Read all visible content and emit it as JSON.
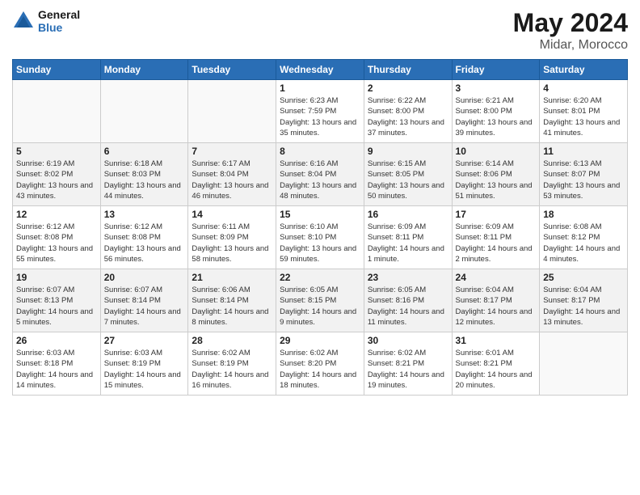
{
  "header": {
    "logo_line1": "General",
    "logo_line2": "Blue",
    "month": "May 2024",
    "location": "Midar, Morocco"
  },
  "weekdays": [
    "Sunday",
    "Monday",
    "Tuesday",
    "Wednesday",
    "Thursday",
    "Friday",
    "Saturday"
  ],
  "weeks": [
    [
      {
        "day": "",
        "info": ""
      },
      {
        "day": "",
        "info": ""
      },
      {
        "day": "",
        "info": ""
      },
      {
        "day": "1",
        "info": "Sunrise: 6:23 AM\nSunset: 7:59 PM\nDaylight: 13 hours\nand 35 minutes."
      },
      {
        "day": "2",
        "info": "Sunrise: 6:22 AM\nSunset: 8:00 PM\nDaylight: 13 hours\nand 37 minutes."
      },
      {
        "day": "3",
        "info": "Sunrise: 6:21 AM\nSunset: 8:00 PM\nDaylight: 13 hours\nand 39 minutes."
      },
      {
        "day": "4",
        "info": "Sunrise: 6:20 AM\nSunset: 8:01 PM\nDaylight: 13 hours\nand 41 minutes."
      }
    ],
    [
      {
        "day": "5",
        "info": "Sunrise: 6:19 AM\nSunset: 8:02 PM\nDaylight: 13 hours\nand 43 minutes."
      },
      {
        "day": "6",
        "info": "Sunrise: 6:18 AM\nSunset: 8:03 PM\nDaylight: 13 hours\nand 44 minutes."
      },
      {
        "day": "7",
        "info": "Sunrise: 6:17 AM\nSunset: 8:04 PM\nDaylight: 13 hours\nand 46 minutes."
      },
      {
        "day": "8",
        "info": "Sunrise: 6:16 AM\nSunset: 8:04 PM\nDaylight: 13 hours\nand 48 minutes."
      },
      {
        "day": "9",
        "info": "Sunrise: 6:15 AM\nSunset: 8:05 PM\nDaylight: 13 hours\nand 50 minutes."
      },
      {
        "day": "10",
        "info": "Sunrise: 6:14 AM\nSunset: 8:06 PM\nDaylight: 13 hours\nand 51 minutes."
      },
      {
        "day": "11",
        "info": "Sunrise: 6:13 AM\nSunset: 8:07 PM\nDaylight: 13 hours\nand 53 minutes."
      }
    ],
    [
      {
        "day": "12",
        "info": "Sunrise: 6:12 AM\nSunset: 8:08 PM\nDaylight: 13 hours\nand 55 minutes."
      },
      {
        "day": "13",
        "info": "Sunrise: 6:12 AM\nSunset: 8:08 PM\nDaylight: 13 hours\nand 56 minutes."
      },
      {
        "day": "14",
        "info": "Sunrise: 6:11 AM\nSunset: 8:09 PM\nDaylight: 13 hours\nand 58 minutes."
      },
      {
        "day": "15",
        "info": "Sunrise: 6:10 AM\nSunset: 8:10 PM\nDaylight: 13 hours\nand 59 minutes."
      },
      {
        "day": "16",
        "info": "Sunrise: 6:09 AM\nSunset: 8:11 PM\nDaylight: 14 hours\nand 1 minute."
      },
      {
        "day": "17",
        "info": "Sunrise: 6:09 AM\nSunset: 8:11 PM\nDaylight: 14 hours\nand 2 minutes."
      },
      {
        "day": "18",
        "info": "Sunrise: 6:08 AM\nSunset: 8:12 PM\nDaylight: 14 hours\nand 4 minutes."
      }
    ],
    [
      {
        "day": "19",
        "info": "Sunrise: 6:07 AM\nSunset: 8:13 PM\nDaylight: 14 hours\nand 5 minutes."
      },
      {
        "day": "20",
        "info": "Sunrise: 6:07 AM\nSunset: 8:14 PM\nDaylight: 14 hours\nand 7 minutes."
      },
      {
        "day": "21",
        "info": "Sunrise: 6:06 AM\nSunset: 8:14 PM\nDaylight: 14 hours\nand 8 minutes."
      },
      {
        "day": "22",
        "info": "Sunrise: 6:05 AM\nSunset: 8:15 PM\nDaylight: 14 hours\nand 9 minutes."
      },
      {
        "day": "23",
        "info": "Sunrise: 6:05 AM\nSunset: 8:16 PM\nDaylight: 14 hours\nand 11 minutes."
      },
      {
        "day": "24",
        "info": "Sunrise: 6:04 AM\nSunset: 8:17 PM\nDaylight: 14 hours\nand 12 minutes."
      },
      {
        "day": "25",
        "info": "Sunrise: 6:04 AM\nSunset: 8:17 PM\nDaylight: 14 hours\nand 13 minutes."
      }
    ],
    [
      {
        "day": "26",
        "info": "Sunrise: 6:03 AM\nSunset: 8:18 PM\nDaylight: 14 hours\nand 14 minutes."
      },
      {
        "day": "27",
        "info": "Sunrise: 6:03 AM\nSunset: 8:19 PM\nDaylight: 14 hours\nand 15 minutes."
      },
      {
        "day": "28",
        "info": "Sunrise: 6:02 AM\nSunset: 8:19 PM\nDaylight: 14 hours\nand 16 minutes."
      },
      {
        "day": "29",
        "info": "Sunrise: 6:02 AM\nSunset: 8:20 PM\nDaylight: 14 hours\nand 18 minutes."
      },
      {
        "day": "30",
        "info": "Sunrise: 6:02 AM\nSunset: 8:21 PM\nDaylight: 14 hours\nand 19 minutes."
      },
      {
        "day": "31",
        "info": "Sunrise: 6:01 AM\nSunset: 8:21 PM\nDaylight: 14 hours\nand 20 minutes."
      },
      {
        "day": "",
        "info": ""
      }
    ]
  ]
}
